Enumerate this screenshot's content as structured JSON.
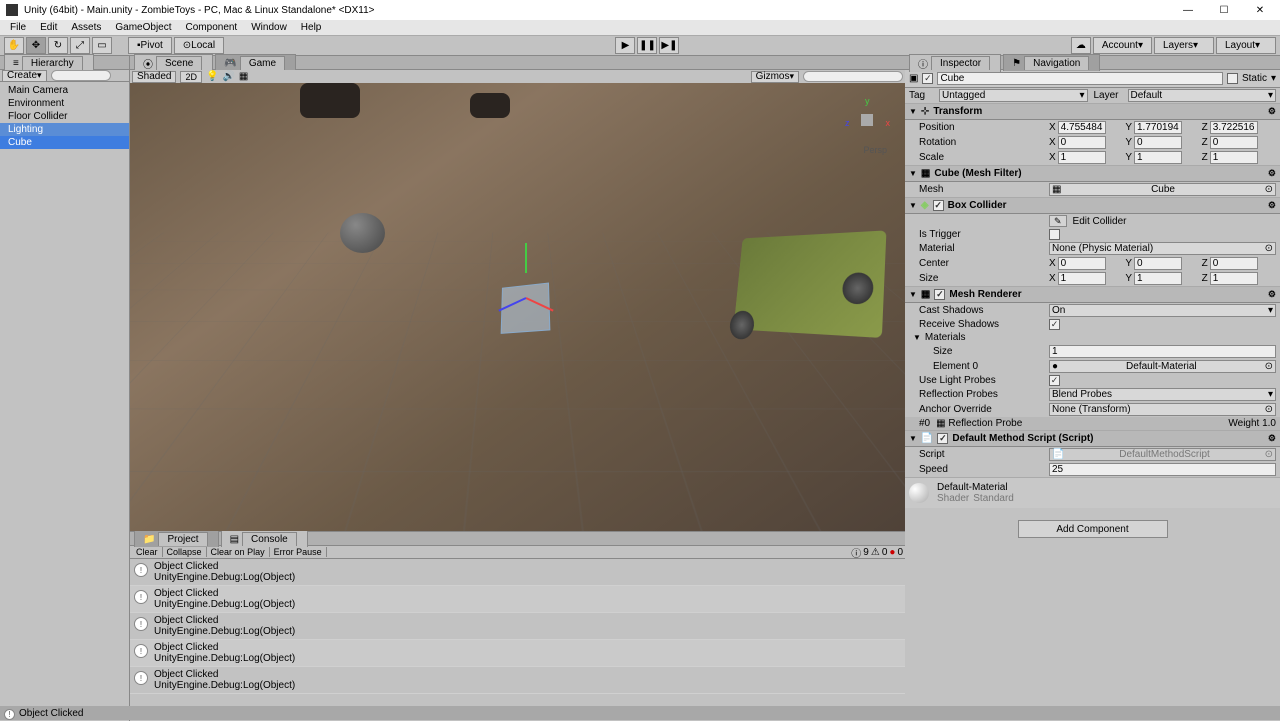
{
  "titlebar": {
    "title": "Unity (64bit) - Main.unity - ZombieToys - PC, Mac & Linux Standalone* <DX11>"
  },
  "menubar": [
    "File",
    "Edit",
    "Assets",
    "GameObject",
    "Component",
    "Window",
    "Help"
  ],
  "toolbar": {
    "pivot": "Pivot",
    "local": "Local",
    "account": "Account",
    "layers": "Layers",
    "layout": "Layout"
  },
  "hierarchy": {
    "tab": "Hierarchy",
    "create": "Create",
    "items": [
      {
        "name": "Main Camera",
        "selected": false
      },
      {
        "name": "Environment",
        "selected": false
      },
      {
        "name": "Floor Collider",
        "selected": false
      },
      {
        "name": "Lighting",
        "selected": false,
        "highlight": true
      },
      {
        "name": "Cube",
        "selected": true
      }
    ]
  },
  "scene": {
    "tab_scene": "Scene",
    "tab_game": "Game",
    "shaded": "Shaded",
    "gizmos": "Gizmos",
    "persp": "Persp"
  },
  "console": {
    "tab_project": "Project",
    "tab_console": "Console",
    "buttons": [
      "Clear",
      "Collapse",
      "Clear on Play",
      "Error Pause"
    ],
    "counts": {
      "info": "9",
      "warn": "0",
      "error": "0"
    },
    "entries": [
      {
        "title": "Object Clicked",
        "detail": "UnityEngine.Debug:Log(Object)"
      },
      {
        "title": "Object Clicked",
        "detail": "UnityEngine.Debug:Log(Object)"
      },
      {
        "title": "Object Clicked",
        "detail": "UnityEngine.Debug:Log(Object)"
      },
      {
        "title": "Object Clicked",
        "detail": "UnityEngine.Debug:Log(Object)"
      },
      {
        "title": "Object Clicked",
        "detail": "UnityEngine.Debug:Log(Object)"
      }
    ]
  },
  "inspector": {
    "tab_inspector": "Inspector",
    "tab_navigation": "Navigation",
    "object_name": "Cube",
    "static_label": "Static",
    "tag_label": "Tag",
    "tag_value": "Untagged",
    "layer_label": "Layer",
    "layer_value": "Default",
    "transform": {
      "title": "Transform",
      "position": {
        "label": "Position",
        "x": "4.755484",
        "y": "1.770194",
        "z": "3.722516"
      },
      "rotation": {
        "label": "Rotation",
        "x": "0",
        "y": "0",
        "z": "0"
      },
      "scale": {
        "label": "Scale",
        "x": "1",
        "y": "1",
        "z": "1"
      }
    },
    "mesh_filter": {
      "title": "Cube (Mesh Filter)",
      "mesh_label": "Mesh",
      "mesh_value": "Cube"
    },
    "box_collider": {
      "title": "Box Collider",
      "edit_collider": "Edit Collider",
      "is_trigger": "Is Trigger",
      "material_label": "Material",
      "material_value": "None (Physic Material)",
      "center": {
        "label": "Center",
        "x": "0",
        "y": "0",
        "z": "0"
      },
      "size": {
        "label": "Size",
        "x": "1",
        "y": "1",
        "z": "1"
      }
    },
    "mesh_renderer": {
      "title": "Mesh Renderer",
      "cast_shadows_label": "Cast Shadows",
      "cast_shadows_value": "On",
      "receive_shadows": "Receive Shadows",
      "materials": "Materials",
      "size_label": "Size",
      "size_value": "1",
      "element0_label": "Element 0",
      "element0_value": "Default-Material",
      "use_light_probes": "Use Light Probes",
      "reflection_probes_label": "Reflection Probes",
      "reflection_probes_value": "Blend Probes",
      "anchor_override_label": "Anchor Override",
      "anchor_override_value": "None (Transform)",
      "reflection_probe_item": "Reflection Probe",
      "weight": "Weight 1.0"
    },
    "script": {
      "title": "Default Method Script (Script)",
      "script_label": "Script",
      "script_value": "DefaultMethodScript",
      "speed_label": "Speed",
      "speed_value": "25"
    },
    "material": {
      "name": "Default-Material",
      "shader_label": "Shader",
      "shader_value": "Standard"
    },
    "add_component": "Add Component"
  },
  "statusbar": {
    "text": "Object Clicked"
  }
}
